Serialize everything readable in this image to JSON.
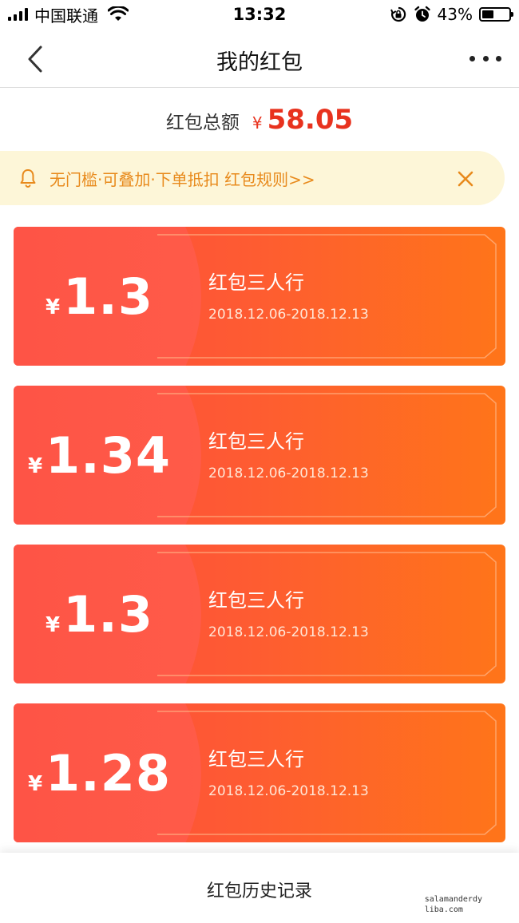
{
  "status_bar": {
    "carrier": "中国联通",
    "time": "13:32",
    "battery_percent": "43%",
    "battery_level": 0.43,
    "icons": [
      "signal-icon",
      "wifi-icon",
      "rotation-lock-icon",
      "alarm-icon",
      "battery-icon"
    ]
  },
  "nav": {
    "title": "我的红包",
    "back_icon": "chevron-left-icon",
    "more_icon": "more-dots-icon"
  },
  "summary": {
    "label": "红包总额",
    "currency": "¥",
    "total": "58.05"
  },
  "notice": {
    "text": "无门槛·可叠加·下单抵扣 红包规则>>",
    "icon": "bell-icon",
    "close_icon": "close-icon"
  },
  "cards": [
    {
      "currency": "¥",
      "amount": "1.3",
      "title": "红包三人行",
      "date_range": "2018.12.06-2018.12.13"
    },
    {
      "currency": "¥",
      "amount": "1.34",
      "title": "红包三人行",
      "date_range": "2018.12.06-2018.12.13"
    },
    {
      "currency": "¥",
      "amount": "1.3",
      "title": "红包三人行",
      "date_range": "2018.12.06-2018.12.13"
    },
    {
      "currency": "¥",
      "amount": "1.28",
      "title": "红包三人行",
      "date_range": "2018.12.06-2018.12.13"
    }
  ],
  "footer": {
    "history_label": "红包历史记录",
    "watermark_line1": "salamanderdy",
    "watermark_line2": "liba.com"
  },
  "colors": {
    "accent_red": "#e8321e",
    "notice_bg": "#fdf6d8",
    "notice_text": "#e88a1c",
    "card_start": "#fc4a3c",
    "card_end": "#ff7519"
  }
}
